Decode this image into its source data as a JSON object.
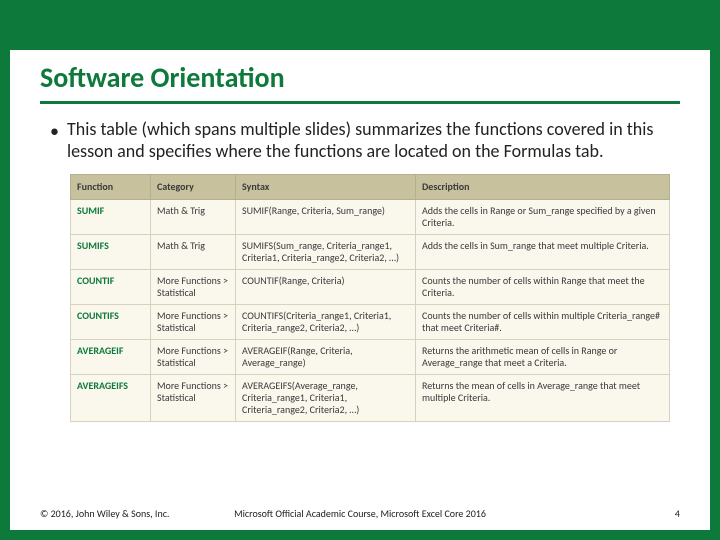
{
  "title": "Software Orientation",
  "bullet": "This table (which spans multiple slides) summarizes the functions covered in this lesson and specifies where the functions are located on the Formulas tab.",
  "table": {
    "headers": [
      "Function",
      "Category",
      "Syntax",
      "Description"
    ],
    "rows": [
      {
        "fn": "SUMIF",
        "cat": "Math & Trig",
        "syn": "SUMIF(Range, Criteria, Sum_range)",
        "desc": "Adds the cells in Range or Sum_range specified by a given Criteria."
      },
      {
        "fn": "SUMIFS",
        "cat": "Math & Trig",
        "syn": "SUMIFS(Sum_range, Criteria_range1, Criteria1, Criteria_range2, Criteria2, …)",
        "desc": "Adds the cells in Sum_range that meet multiple Criteria."
      },
      {
        "fn": "COUNTIF",
        "cat": "More Functions > Statistical",
        "syn": "COUNTIF(Range, Criteria)",
        "desc": "Counts the number of cells within Range that meet the Criteria."
      },
      {
        "fn": "COUNTIFS",
        "cat": "More Functions > Statistical",
        "syn": "COUNTIFS(Criteria_range1, Criteria1, Criteria_range2, Criteria2, …)",
        "desc": "Counts the number of cells within multiple Criteria_range# that meet Criteria#."
      },
      {
        "fn": "AVERAGEIF",
        "cat": "More Functions > Statistical",
        "syn": "AVERAGEIF(Range, Criteria, Average_range)",
        "desc": "Returns the arithmetic mean of cells in Range or Average_range that meet a Criteria."
      },
      {
        "fn": "AVERAGEIFS",
        "cat": "More Functions > Statistical",
        "syn": "AVERAGEIFS(Average_range, Criteria_range1, Criteria1, Criteria_range2, Criteria2, …)",
        "desc": "Returns the mean of cells in Average_range that meet multiple Criteria."
      }
    ]
  },
  "footer": {
    "left": "© 2016, John Wiley & Sons, Inc.",
    "center": "Microsoft Official Academic Course, Microsoft Excel Core 2016",
    "right": "4"
  }
}
